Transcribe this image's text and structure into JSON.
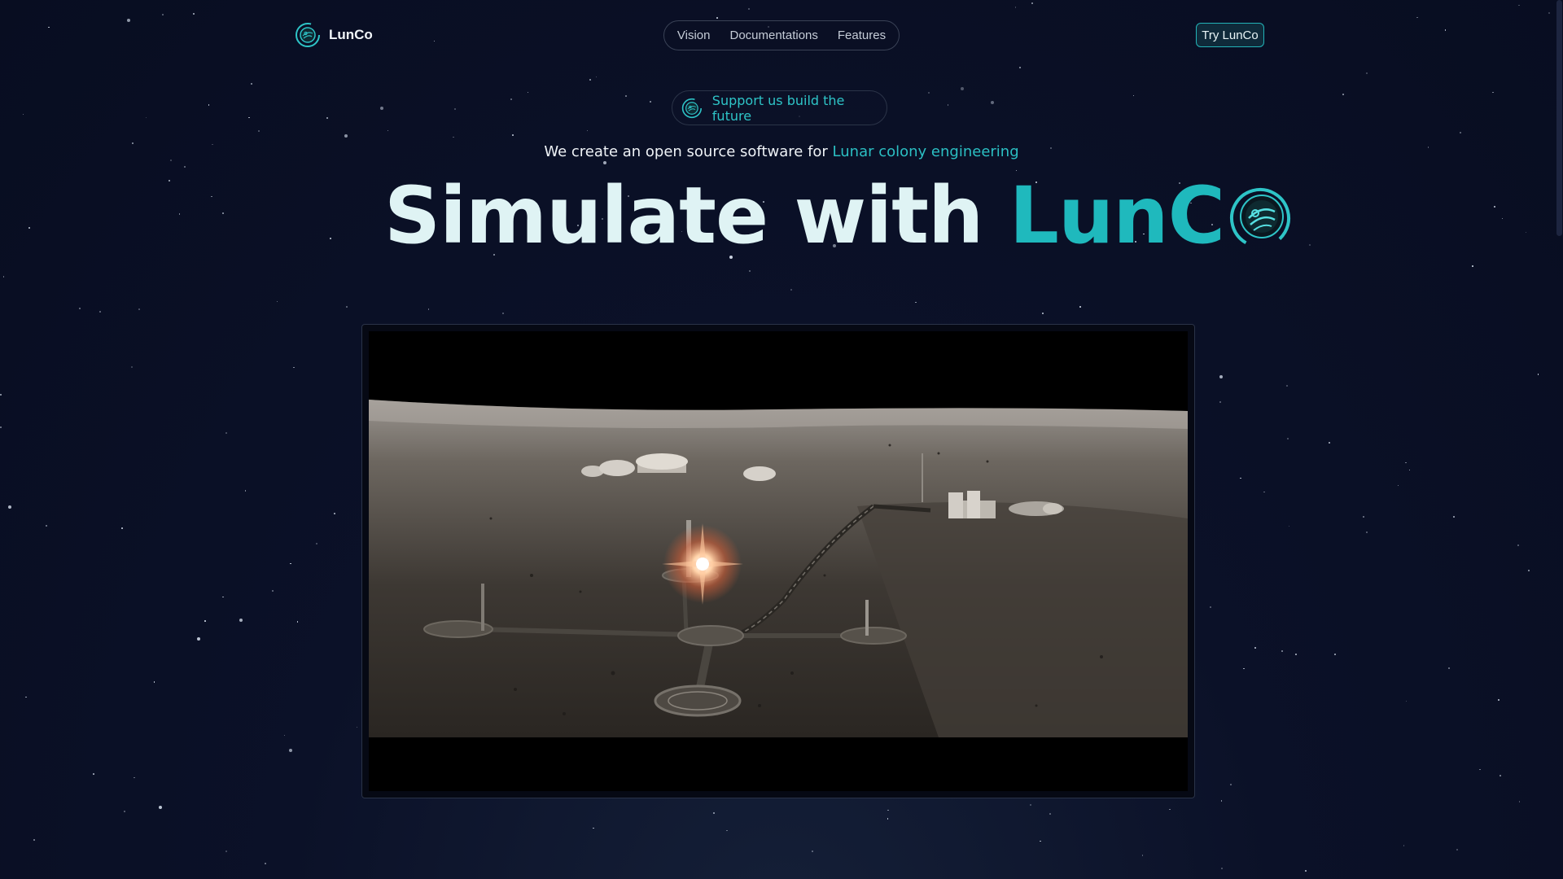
{
  "nav": {
    "brand": "LunCo",
    "links": [
      "Vision",
      "Documentations",
      "Features"
    ],
    "cta": "Try LunCo"
  },
  "badge": {
    "label": "Support us build the future"
  },
  "tagline": {
    "prefix": "We create an open source software for ",
    "accent": "Lunar colony engineering"
  },
  "hero": {
    "prefix": "Simulate with ",
    "brand": "LunC"
  },
  "colors": {
    "background": "#0a0f24",
    "accent": "#1fb9bd",
    "hero_text": "#dff3f4"
  },
  "icons": {
    "logo": "planet-orbit-icon",
    "badge": "planet-orbit-icon",
    "hero": "planet-orbit-icon"
  }
}
